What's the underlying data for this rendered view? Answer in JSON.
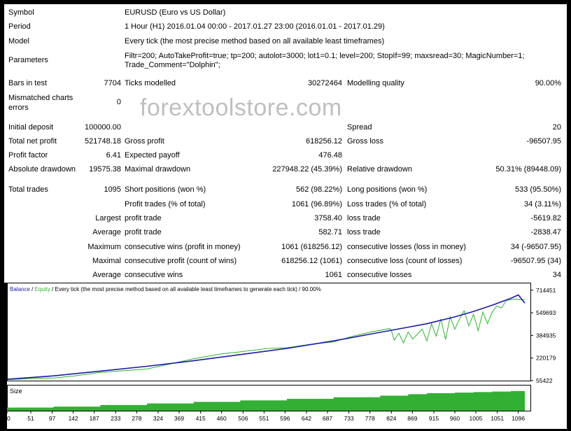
{
  "header": [
    {
      "label": "Symbol",
      "value": "EURUSD (Euro vs US Dollar)"
    },
    {
      "label": "Period",
      "value": "1 Hour (H1) 2016.01.04 00:00 - 2017.01.27 23:00 (2016.01.01 - 2017.01.29)"
    },
    {
      "label": "Model",
      "value": "Every tick (the most precise method based on all available least timeframes)"
    },
    {
      "label": "Parameters",
      "value": "Filtr=200; AutoTakeProfit=true; tp=200; autolot=3000; lot1=0.1; level=200; StopIf=99; maxsread=30; MagicNumber=1;",
      "value2": "Trade_Comment=\"Dolphin\";"
    }
  ],
  "stats": {
    "bars_label": "Bars in test",
    "bars_value": "7704",
    "ticks_label": "Ticks modelled",
    "ticks_value": "30272464",
    "quality_label": "Modelling quality",
    "quality_value": "90.00%",
    "mismatch_label1": "Mismatched charts",
    "mismatch_label2": "errors",
    "mismatch_value": "0",
    "initial_label": "Initial deposit",
    "initial_value": "100000.00",
    "spread_label": "Spread",
    "spread_value": "20",
    "netprofit_label": "Total net profit",
    "netprofit_value": "521748.18",
    "grossprofit_label": "Gross profit",
    "grossprofit_value": "618256.12",
    "grossloss_label": "Gross loss",
    "grossloss_value": "-96507.95",
    "pf_label": "Profit factor",
    "pf_value": "6.41",
    "payoff_label": "Expected payoff",
    "payoff_value": "476.48",
    "absdd_label": "Absolute drawdown",
    "absdd_value": "19575.38",
    "maxdd_label": "Maximal drawdown",
    "maxdd_value": "227948.22 (45.39%)",
    "reldd_label": "Relative drawdown",
    "reldd_value": "50.31% (89448.09)",
    "trades_label": "Total trades",
    "trades_value": "1095",
    "short_label": "Short positions (won %)",
    "short_value": "562 (98.22%)",
    "long_label": "Long positions (won %)",
    "long_value": "533 (95.50%)",
    "pt_label": "Profit trades (% of total)",
    "pt_value": "1061 (96.89%)",
    "lt_label": "Loss trades (% of total)",
    "lt_value": "34 (3.11%)",
    "largest": "Largest",
    "largest_pt_label": "profit trade",
    "largest_pt_value": "3758.40",
    "largest_lt_label": "loss trade",
    "largest_lt_value": "-5619.82",
    "average": "Average",
    "average_pt_label": "profit trade",
    "average_pt_value": "582.71",
    "average_lt_label": "loss trade",
    "average_lt_value": "-2838.47",
    "maximum": "Maximum",
    "max_cw_label": "consecutive wins (profit in money)",
    "max_cw_value": "1061 (618256.12)",
    "max_cl_label": "consecutive losses (loss in money)",
    "max_cl_value": "34 (-96507.95)",
    "maximal": "Maximal",
    "mxl_cp_label": "consecutive profit (count of wins)",
    "mxl_cp_value": "618256.12 (1061)",
    "mxl_cl_label": "consecutive loss (count of losses)",
    "mxl_cl_value": "-96507.95 (34)",
    "average2": "Average",
    "avg_cw_label": "consecutive wins",
    "avg_cw_value": "1061",
    "avg_cl_label": "consecutive losses",
    "avg_cl_value": "34"
  },
  "watermark": "forextoolstore.com",
  "chart_data": {
    "type": "line",
    "legend": {
      "balance": "Balance",
      "sep1": " / ",
      "equity": "Equity",
      "rest": " / Every tick (the most precise method based on all available least timeframes to generate each tick) / 90.00%"
    },
    "size_label": "Size",
    "x_ticks": [
      0,
      51,
      97,
      142,
      187,
      233,
      278,
      324,
      369,
      415,
      460,
      506,
      551,
      596,
      642,
      687,
      733,
      778,
      824,
      869,
      915,
      960,
      1005,
      1051,
      1096
    ],
    "y_ticks": [
      714451,
      549693,
      384935,
      220179,
      55422
    ],
    "xlim": [
      0,
      1122
    ],
    "ylim": [
      55422,
      769370
    ],
    "colors": {
      "balance": "#1a1aa6",
      "equity": "#2bb52b",
      "size": "#33b033"
    },
    "balance": {
      "x": [
        0,
        100,
        200,
        300,
        400,
        500,
        600,
        700,
        780,
        860,
        900,
        960,
        1000,
        1040,
        1060,
        1080,
        1096,
        1110
      ],
      "y": [
        65000,
        90000,
        125000,
        160000,
        200000,
        245000,
        290000,
        345000,
        395000,
        445000,
        470000,
        520000,
        560000,
        605000,
        630000,
        655000,
        680000,
        620000
      ]
    },
    "equity": {
      "x": [
        0,
        60,
        100,
        140,
        200,
        260,
        300,
        360,
        400,
        460,
        500,
        560,
        600,
        650,
        700,
        740,
        780,
        820,
        824,
        830,
        840,
        850,
        860,
        870,
        880,
        890,
        900,
        910,
        920,
        930,
        940,
        950,
        960,
        970,
        980,
        990,
        1000,
        1010,
        1020,
        1030,
        1040,
        1050,
        1060,
        1070,
        1080,
        1090,
        1100,
        1110
      ],
      "y": [
        62000,
        72000,
        75000,
        88000,
        115000,
        130000,
        140000,
        185000,
        215000,
        250000,
        265000,
        290000,
        295000,
        320000,
        338000,
        378000,
        410000,
        435000,
        420000,
        350000,
        400000,
        330000,
        410000,
        360000,
        395000,
        430000,
        345000,
        470000,
        380000,
        505000,
        355000,
        520000,
        430000,
        505000,
        565000,
        455000,
        540000,
        420000,
        555000,
        470000,
        555000,
        600000,
        585000,
        640000,
        645000,
        650000,
        645000,
        645000
      ]
    },
    "size": {
      "x": [
        0,
        100,
        200,
        300,
        400,
        500,
        600,
        700,
        800,
        860,
        900,
        960,
        1000,
        1040,
        1080,
        1110
      ],
      "v": [
        12,
        16,
        22,
        28,
        34,
        40,
        46,
        52,
        58,
        64,
        68,
        70,
        72,
        74,
        76,
        66
      ]
    }
  }
}
